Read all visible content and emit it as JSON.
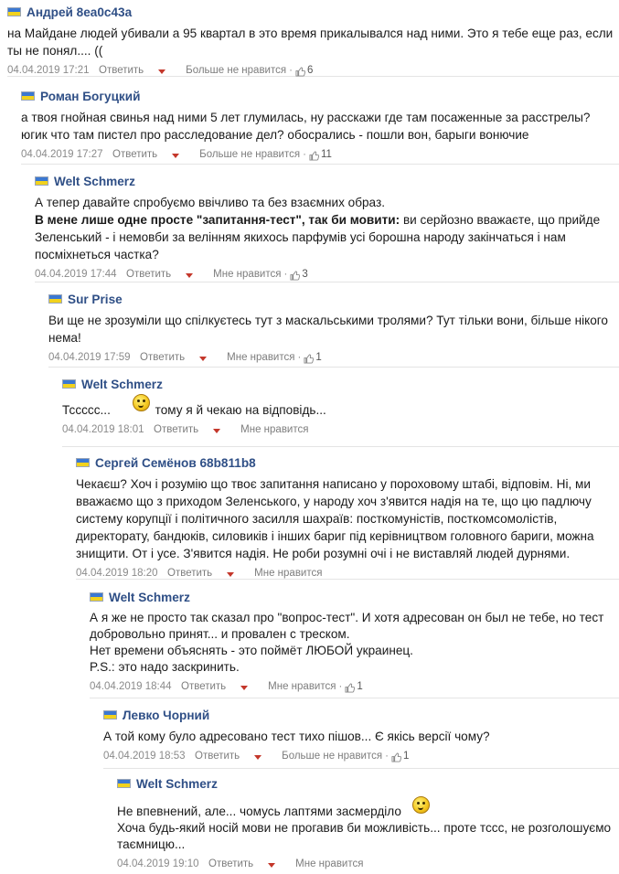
{
  "colors": {
    "author": "#2f4f86",
    "caret": "#c4372b",
    "flag_top": "#3b78d2",
    "flag_bottom": "#f2d21d"
  },
  "comments": [
    {
      "author": "Андрей 8ea0c43a",
      "lines": [
        "на Майдане людей убивали а 95 квартал в это время прикалывался над ними. Это я тебе еще раз, если ты не понял.... (("
      ],
      "date": "04.04.2019 17:21",
      "reply": "Ответить",
      "like": "Больше не нравится",
      "likes": "6"
    },
    {
      "author": "Роман Богуцкий",
      "lines": [
        "а твоя гнойная свинья над ними 5 лет глумилась, ну расскажи где там посаженные за расстрелы? югик что там пистел про расследование дел? обосрались - пошли вон, барыги вонючие"
      ],
      "date": "04.04.2019 17:27",
      "reply": "Ответить",
      "like": "Больше не нравится",
      "likes": "11"
    },
    {
      "author": "Welt Schmerz",
      "lines": [
        "А тепер давайте спробуємо ввічливо та без взаємних образ."
      ],
      "bold_lead": "В мене лише одне просте \"запитання-тест\", так би мовити:",
      "bold_rest": " ви серйозно вважаєте, що прийде Зеленський - і немовби за велінням якихось парфумів усі борошна народу закінчаться і нам посміхнеться частка?",
      "date": "04.04.2019 17:44",
      "reply": "Ответить",
      "like": "Мне нравится",
      "likes": "3"
    },
    {
      "author": "Sur Prise",
      "lines": [
        "Ви ще не зрозуміли що спілкуєтесь тут з маскальськими тролями? Тут тільки вони, більше нікого нема!"
      ],
      "date": "04.04.2019 17:59",
      "reply": "Ответить",
      "like": "Мне нравится",
      "likes": "1"
    },
    {
      "author": "Welt Schmerz",
      "text_before": "Тссссс...",
      "text_after": "тому я й чекаю на відповідь...",
      "date": "04.04.2019 18:01",
      "reply": "Ответить",
      "like": "Мне нравится"
    },
    {
      "author": "Сергей Семёнов 68b811b8",
      "lines": [
        "Чекаєш? Хоч і розумію що твоє запитання написано у пороховому штабі, відповім. Ні, ми вважаємо що з приходом Зеленського, у народу хоч з'явится надія на те, що цю падлючу систему корупції і політичного засилля шахраїв: посткомуністів, посткомсомолістів, директорату, бандюків, силовиків і інших бариг під керівництвом головного бариги, можна знищити. От і усе. З'явится надія. Не роби розумні очі і не виставляй людей дурнями."
      ],
      "date": "04.04.2019 18:20",
      "reply": "Ответить",
      "like": "Мне нравится"
    },
    {
      "author": "Welt Schmerz",
      "lines": [
        "А я же не просто так сказал про \"вопрос-тест\". И хотя адресован он был не тебе, но тест добровольно принят... и провален с треском.",
        "Нет времени объяснять - это поймёт ЛЮБОЙ украинец.",
        "P.S.: это надо заскринить."
      ],
      "date": "04.04.2019 18:44",
      "reply": "Ответить",
      "like": "Мне нравится",
      "likes": "1"
    },
    {
      "author": "Левко Чорний",
      "lines": [
        "А той кому було адресовано тест тихо пішов... Є якісь версії чому?"
      ],
      "date": "04.04.2019 18:53",
      "reply": "Ответить",
      "like": "Больше не нравится",
      "likes": "1"
    },
    {
      "author": "Welt Schmerz",
      "first_line": "Не впевнений, але... чомусь лаптями засмердiло",
      "lines": [
        "Хоча будь-який носій мови не прогавив би можливість... проте тссс, не розголошуємо таємницю..."
      ],
      "date": "04.04.2019 19:10",
      "reply": "Ответить",
      "like": "Мне нравится"
    }
  ]
}
